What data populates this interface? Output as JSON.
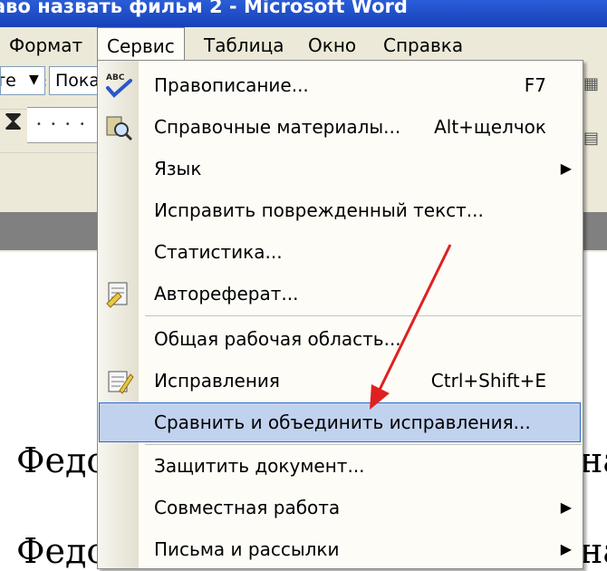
{
  "window": {
    "title": "аво назвать фильм 2 - Microsoft Word"
  },
  "menubar": {
    "items": [
      {
        "label": "Формат",
        "open": false
      },
      {
        "label": "Сервис",
        "open": true
      },
      {
        "label": "Таблица",
        "open": false
      },
      {
        "label": "Окно",
        "open": false
      },
      {
        "label": "Справка",
        "open": false
      }
    ]
  },
  "toolbar": {
    "style_value": "те",
    "font_value": "Пока"
  },
  "document": {
    "line1_left": "Федо",
    "line1_right": "на",
    "line2_left": "Федо",
    "line2_right": "на"
  },
  "dropdown": {
    "items": [
      {
        "label": "Правописание...",
        "shortcut": "F7",
        "icon": "spelling-abc-icon"
      },
      {
        "label": "Справочные материалы...",
        "shortcut": "Alt+щелчок",
        "icon": "research-icon"
      },
      {
        "label": "Язык",
        "submenu": true
      },
      {
        "label": "Исправить поврежденный текст..."
      },
      {
        "label": "Статистика..."
      },
      {
        "label": "Автореферат...",
        "icon": "autosummarize-icon"
      },
      {
        "label": "Общая рабочая область..."
      },
      {
        "label": "Исправления",
        "shortcut": "Ctrl+Shift+E",
        "icon": "track-changes-icon"
      },
      {
        "label": "Сравнить и объединить исправления...",
        "highlighted": true
      },
      {
        "label": "Защитить документ..."
      },
      {
        "label": "Совместная работа",
        "submenu": true
      },
      {
        "label": "Письма и рассылки",
        "submenu": true
      }
    ]
  },
  "colors": {
    "highlight_bg": "#c1d2ee",
    "highlight_border": "#316ac5",
    "arrow": "#e02020",
    "titlebar": "#1f4fc8"
  }
}
